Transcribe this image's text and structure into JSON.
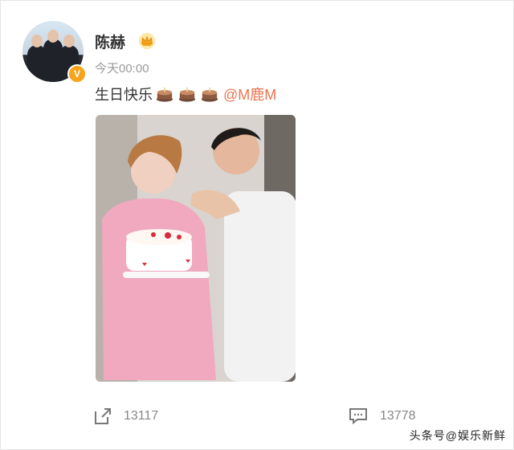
{
  "user": {
    "name": "陈赫",
    "time": "今天00:00",
    "verified_icon": "v-badge-icon",
    "vip_icon": "crown-icon"
  },
  "post": {
    "text": "生日快乐",
    "emoji": [
      "cake-icon",
      "cake-icon",
      "cake-icon"
    ],
    "mention": "@M鹿M"
  },
  "image": {
    "description_icon": "photo-icon"
  },
  "actions": {
    "share_count": "13117",
    "comment_count": "13778"
  },
  "watermark": "头条号@娱乐新鲜"
}
